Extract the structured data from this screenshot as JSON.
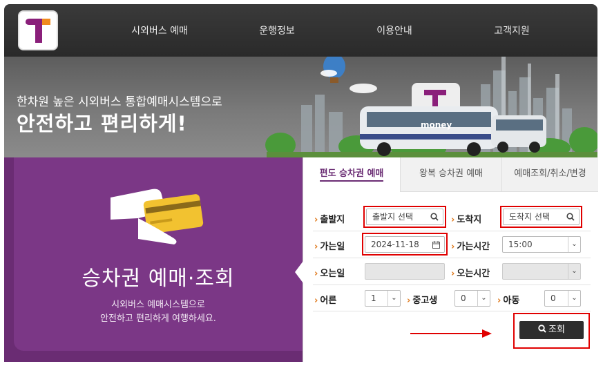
{
  "nav": {
    "items": [
      "시외버스 예매",
      "운행정보",
      "이용안내",
      "고객지원"
    ]
  },
  "hero": {
    "subtitle": "한차원 높은 시외버스 통합예매시스템으로",
    "title": "안전하고 편리하게!",
    "bus_brand": "money"
  },
  "promo": {
    "title": "승차권 예매·조회",
    "desc_line1": "시외버스 예매시스템으로",
    "desc_line2": "안전하고 편리하게 여행하세요."
  },
  "tabs": [
    {
      "label": "편도 승차권 예매",
      "active": true
    },
    {
      "label": "왕복 승차권 예매",
      "active": false
    },
    {
      "label": "예매조회/취소/변경",
      "active": false
    }
  ],
  "form": {
    "chev": "›",
    "departure_label": "출발지",
    "departure_placeholder": "출발지 선택",
    "arrival_label": "도착지",
    "arrival_placeholder": "도착지 선택",
    "go_date_label": "가는일",
    "go_date_value": "2024-11-18",
    "go_time_label": "가는시간",
    "go_time_value": "15:00",
    "return_date_label": "오는일",
    "return_time_label": "오는시간",
    "adult_label": "어른",
    "adult_value": "1",
    "teen_label": "중고생",
    "teen_value": "0",
    "child_label": "아동",
    "child_value": "0",
    "search_label": "조회"
  },
  "colors": {
    "brand_purple": "#6a2c73",
    "accent_orange": "#e07b1e",
    "highlight_red": "#e00000"
  },
  "icons": {
    "search": "search-icon",
    "calendar": "calendar-icon",
    "dropdown": "chevron-down-icon"
  }
}
